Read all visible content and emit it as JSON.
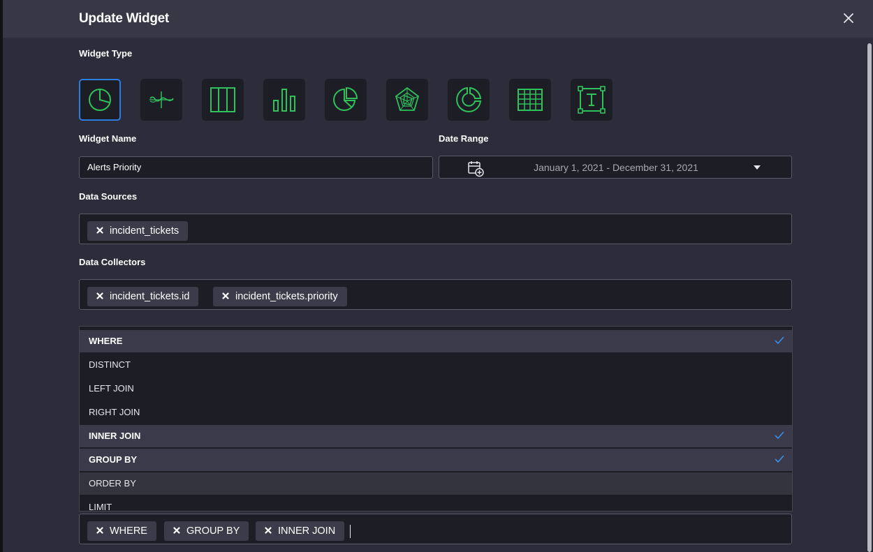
{
  "modal": {
    "title": "Update Widget",
    "close_icon": "close-icon"
  },
  "widget_type": {
    "label": "Widget Type",
    "types": [
      {
        "name": "pie-chart",
        "icon": "pie-chart-icon",
        "selected": true
      },
      {
        "name": "line-chart",
        "icon": "line-chart-icon",
        "selected": false
      },
      {
        "name": "column-layout",
        "icon": "columns-icon",
        "selected": false
      },
      {
        "name": "bar-chart",
        "icon": "bar-chart-icon",
        "selected": false
      },
      {
        "name": "pie-exploded",
        "icon": "pie-exploded-icon",
        "selected": false
      },
      {
        "name": "radar-chart",
        "icon": "radar-icon",
        "selected": false
      },
      {
        "name": "donut-chart",
        "icon": "donut-icon",
        "selected": false
      },
      {
        "name": "table",
        "icon": "table-icon",
        "selected": false
      },
      {
        "name": "text",
        "icon": "text-box-icon",
        "selected": false
      }
    ]
  },
  "widget_name": {
    "label": "Widget Name",
    "value": "Alerts Priority"
  },
  "date_range": {
    "label": "Date Range",
    "value": "January 1, 2021 - December 31, 2021"
  },
  "data_sources": {
    "label": "Data Sources",
    "chips": [
      "incident_tickets"
    ]
  },
  "data_collectors": {
    "label": "Data Collectors",
    "chips": [
      "incident_tickets.id",
      "incident_tickets.priority"
    ]
  },
  "clauses": {
    "options": [
      {
        "label": "WHERE",
        "selected": true
      },
      {
        "label": "DISTINCT",
        "selected": false
      },
      {
        "label": "LEFT JOIN",
        "selected": false
      },
      {
        "label": "RIGHT JOIN",
        "selected": false
      },
      {
        "label": "INNER JOIN",
        "selected": true
      },
      {
        "label": "GROUP BY",
        "selected": true
      },
      {
        "label": "ORDER BY",
        "selected": false
      },
      {
        "label": "LIMIT",
        "selected": false
      }
    ],
    "chips": [
      "WHERE",
      "GROUP BY",
      "INNER JOIN"
    ]
  },
  "colors": {
    "accent": "#2a7de1",
    "icon_green": "#2fc25b",
    "check_blue": "#3f8ee6",
    "background": "#2c2c3a"
  }
}
